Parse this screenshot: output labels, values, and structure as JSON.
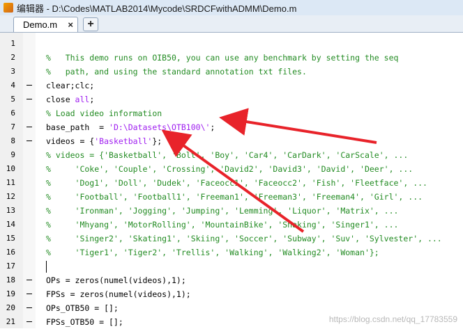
{
  "window": {
    "title": "编辑器 - D:\\Codes\\MATLAB2014\\Mycode\\SRDCFwithADMM\\Demo.m"
  },
  "tabs": [
    {
      "label": "Demo.m",
      "close": "×"
    }
  ],
  "add_tab_label": "+",
  "editor": {
    "lines": [
      {
        "n": "1",
        "dash": false,
        "parts": []
      },
      {
        "n": "2",
        "dash": false,
        "parts": [
          {
            "t": "%   This demo runs on OIB50, you can use any benchmark by setting the seq",
            "c": "com"
          }
        ]
      },
      {
        "n": "3",
        "dash": false,
        "parts": [
          {
            "t": "%   path, and using the standard annotation txt files.",
            "c": "com"
          }
        ]
      },
      {
        "n": "4",
        "dash": true,
        "parts": [
          {
            "t": "clear;clc;",
            "c": ""
          }
        ]
      },
      {
        "n": "5",
        "dash": true,
        "parts": [
          {
            "t": "close ",
            "c": ""
          },
          {
            "t": "all",
            "c": "str"
          },
          {
            "t": ";",
            "c": ""
          }
        ]
      },
      {
        "n": "6",
        "dash": false,
        "parts": [
          {
            "t": "% Load video information",
            "c": "com"
          }
        ]
      },
      {
        "n": "7",
        "dash": true,
        "parts": [
          {
            "t": "base_path  = ",
            "c": ""
          },
          {
            "t": "'D:\\Datasets\\OTB100\\'",
            "c": "str"
          },
          {
            "t": ";",
            "c": ""
          }
        ]
      },
      {
        "n": "8",
        "dash": true,
        "parts": [
          {
            "t": "videos = {",
            "c": ""
          },
          {
            "t": "'Basketball'",
            "c": "str"
          },
          {
            "t": "};",
            "c": ""
          }
        ]
      },
      {
        "n": "9",
        "dash": false,
        "parts": [
          {
            "t": "% videos = {'Basketball', 'Bolt', 'Boy', 'Car4', 'CarDark', 'CarScale', ...",
            "c": "com"
          }
        ]
      },
      {
        "n": "10",
        "dash": false,
        "parts": [
          {
            "t": "%     'Coke', 'Couple', 'Crossing', 'David2', 'David3', 'David', 'Deer', ...",
            "c": "com"
          }
        ]
      },
      {
        "n": "11",
        "dash": false,
        "parts": [
          {
            "t": "%     'Dog1', 'Doll', 'Dudek', 'Faceocc1', 'Faceocc2', 'Fish', 'Fleetface', ...",
            "c": "com"
          }
        ]
      },
      {
        "n": "12",
        "dash": false,
        "parts": [
          {
            "t": "%     'Football', 'Football1', 'Freeman1', 'Freeman3', 'Freeman4', 'Girl', ...",
            "c": "com"
          }
        ]
      },
      {
        "n": "13",
        "dash": false,
        "parts": [
          {
            "t": "%     'Ironman', 'Jogging', 'Jumping', 'Lemming', 'Liquor', 'Matrix', ...",
            "c": "com"
          }
        ]
      },
      {
        "n": "14",
        "dash": false,
        "parts": [
          {
            "t": "%     'Mhyang', 'MotorRolling', 'MountainBike', 'Shaking', 'Singer1', ...",
            "c": "com"
          }
        ]
      },
      {
        "n": "15",
        "dash": false,
        "parts": [
          {
            "t": "%     'Singer2', 'Skating1', 'Skiing', 'Soccer', 'Subway', 'Suv', 'Sylvester', ...",
            "c": "com"
          }
        ]
      },
      {
        "n": "16",
        "dash": false,
        "parts": [
          {
            "t": "%     'Tiger1', 'Tiger2', 'Trellis', 'Walking', 'Walking2', 'Woman'};",
            "c": "com"
          }
        ]
      },
      {
        "n": "17",
        "dash": false,
        "parts": []
      },
      {
        "n": "18",
        "dash": true,
        "parts": [
          {
            "t": "OPs = zeros(numel(videos),1);",
            "c": ""
          }
        ]
      },
      {
        "n": "19",
        "dash": true,
        "parts": [
          {
            "t": "FPSs = zeros(numel(videos),1);",
            "c": ""
          }
        ]
      },
      {
        "n": "20",
        "dash": true,
        "parts": [
          {
            "t": "OPs_OTB50 = [];",
            "c": ""
          }
        ]
      },
      {
        "n": "21",
        "dash": true,
        "parts": [
          {
            "t": "FPSs_OTB50 = [];",
            "c": ""
          }
        ]
      }
    ]
  },
  "colors": {
    "comment": "#228b22",
    "string": "#a020f0",
    "annotation_arrow": "#e8232a"
  },
  "watermark": "https://blog.csdn.net/qq_17783559"
}
